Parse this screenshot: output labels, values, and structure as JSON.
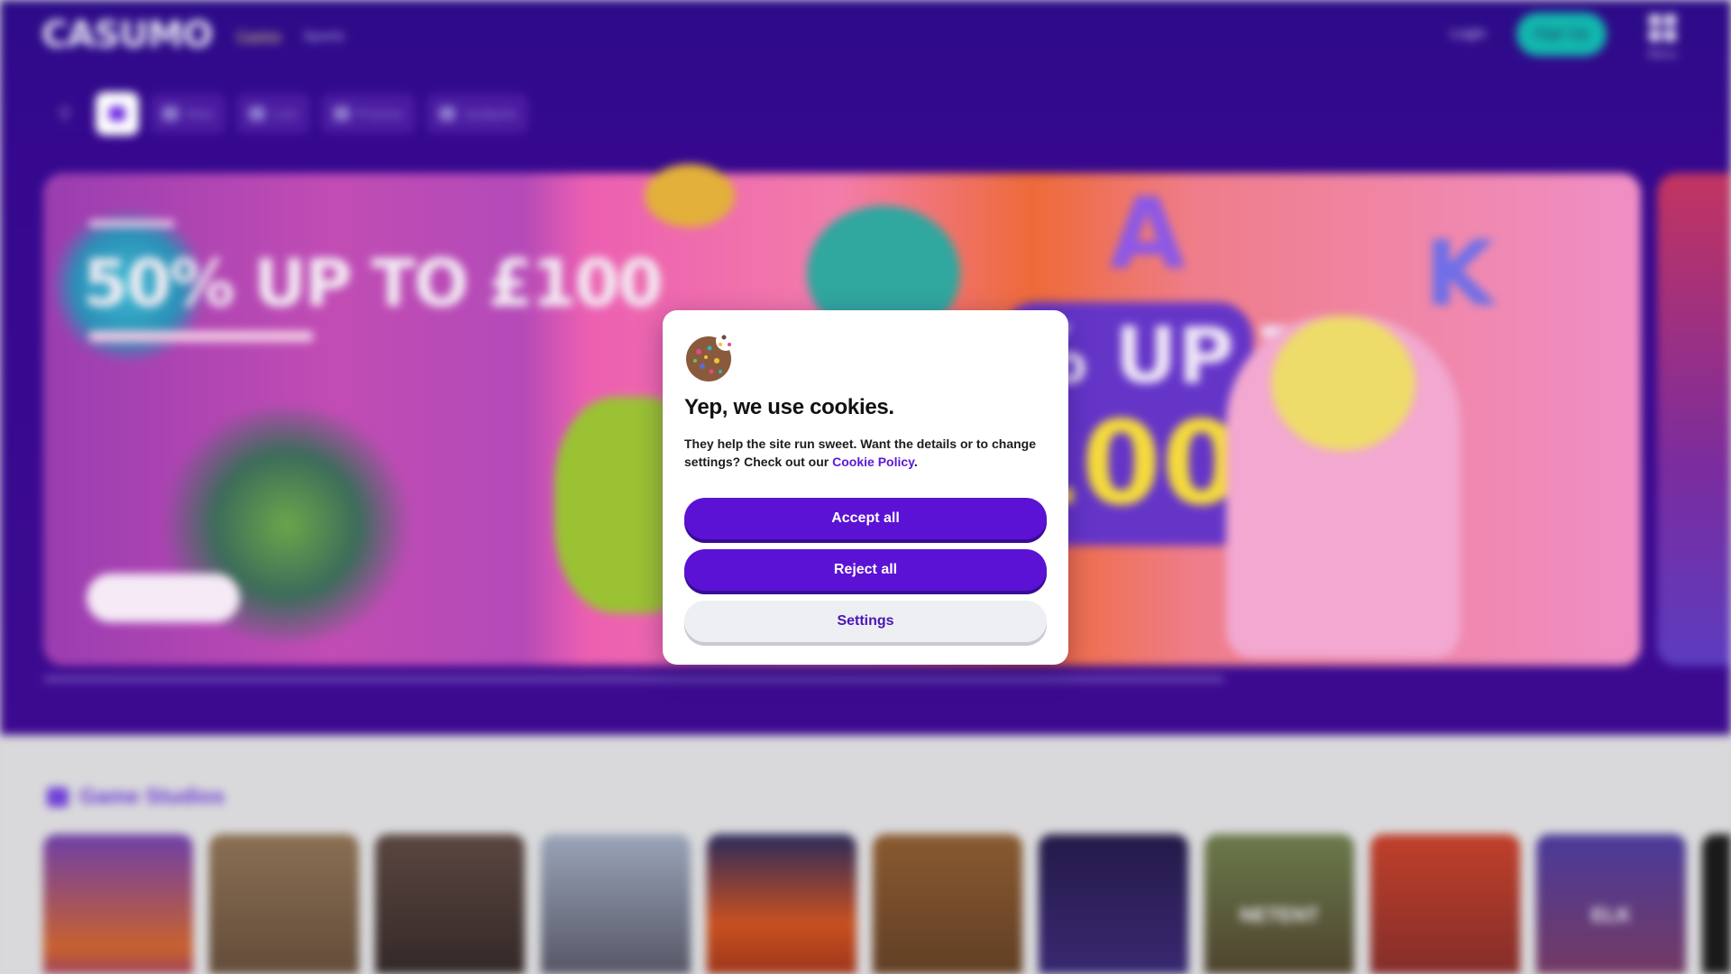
{
  "header": {
    "logo": "CASUMO",
    "nav": [
      "Casino",
      "Sports"
    ],
    "login": "Login",
    "signup": "Sign Up",
    "menu_label": "Menu"
  },
  "categories": [
    "New",
    "Live",
    "Promos",
    "Jackpots"
  ],
  "banner": {
    "headline": "50% UP TO £100",
    "center_text_1": "% UP TO",
    "center_text_2": "100"
  },
  "studios": {
    "title": "Game Studios",
    "tiles": [
      "",
      "",
      "",
      "",
      "",
      "",
      "",
      "NETENT",
      "",
      "ELK",
      ""
    ]
  },
  "cookie_modal": {
    "title": "Yep, we use cookies.",
    "text_before_link": "They help the site run sweet. Want the details or to change settings? Check out our ",
    "link_text": "Cookie Policy",
    "text_after_link": ".",
    "accept_label": "Accept all",
    "reject_label": "Reject all",
    "settings_label": "Settings"
  },
  "colors": {
    "primary": "#5b12d4",
    "header_bg": "#35088e",
    "signup_bg": "#12b6ae",
    "link": "#5b17d8"
  }
}
